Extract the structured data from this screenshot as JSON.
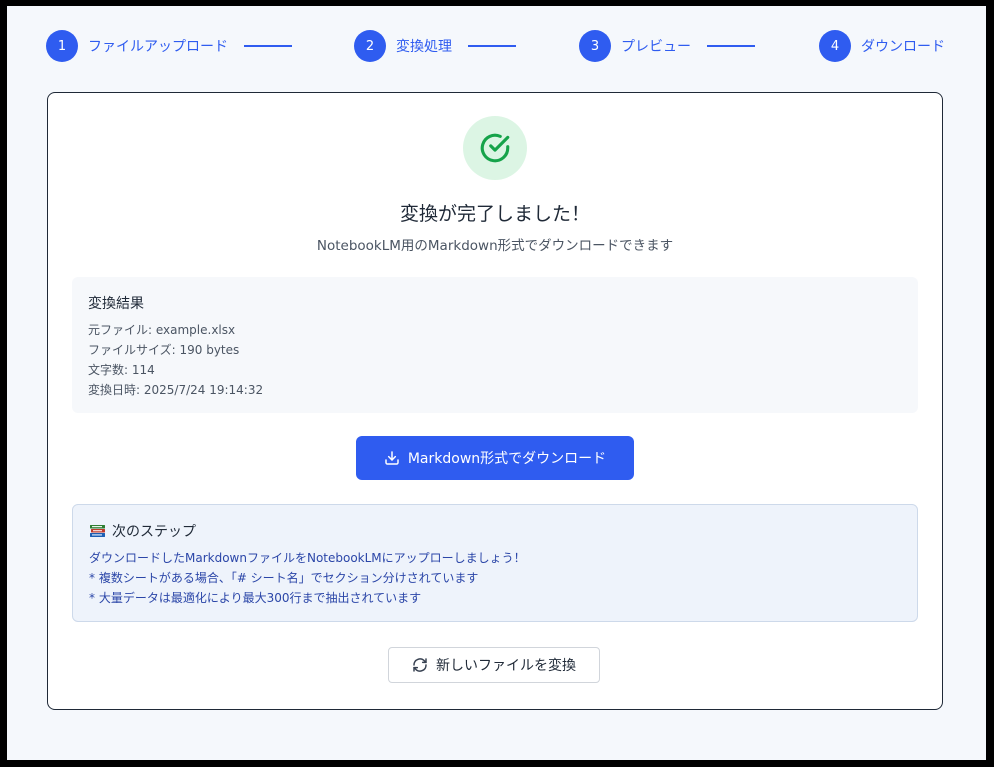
{
  "steps": [
    {
      "number": "1",
      "label": "ファイルアップロード"
    },
    {
      "number": "2",
      "label": "変換処理"
    },
    {
      "number": "3",
      "label": "プレビュー"
    },
    {
      "number": "4",
      "label": "ダウンロード"
    }
  ],
  "success": {
    "icon": "check-circle-icon",
    "title": "変換が完了しました！",
    "subtitle": "NotebookLM用のMarkdown形式でダウンロードできます"
  },
  "result": {
    "title": "変換結果",
    "lines": [
      "元ファイル: example.xlsx",
      "ファイルサイズ: 190 bytes",
      "文字数: 114",
      "変換日時: 2025/7/24 19:14:32"
    ]
  },
  "download_button": {
    "label": "Markdown形式でダウンロード",
    "icon": "download-icon"
  },
  "next_steps": {
    "icon": "books-icon",
    "title": "次のステップ",
    "lines": [
      "ダウンロードしたMarkdownファイルをNotebookLMにアップローしましょう！",
      "* 複数シートがある場合、「# シート名」でセクション分けされています",
      "* 大量データは最適化により最大300行まで抽出されています"
    ]
  },
  "reset_button": {
    "label": "新しいファイルを変換",
    "icon": "refresh-icon"
  },
  "colors": {
    "accent": "#2f5cf0",
    "success_bg": "#dcf5e4",
    "success": "#16a34a"
  }
}
